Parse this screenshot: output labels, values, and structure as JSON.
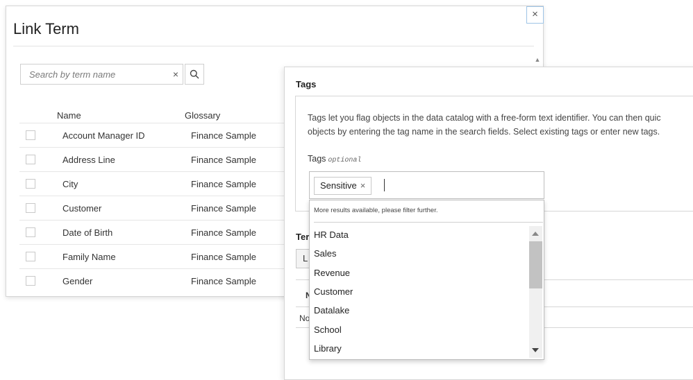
{
  "dialog": {
    "title": "Link Term",
    "close_label": "×",
    "search": {
      "placeholder": "Search by term name",
      "clear_label": "×"
    },
    "columns": {
      "name": "Name",
      "glossary": "Glossary"
    },
    "rows": [
      {
        "name": "Account Manager ID",
        "glossary": "Finance Sample"
      },
      {
        "name": "Address Line",
        "glossary": "Finance Sample"
      },
      {
        "name": "City",
        "glossary": "Finance Sample"
      },
      {
        "name": "Customer",
        "glossary": "Finance Sample"
      },
      {
        "name": "Date of Birth",
        "glossary": "Finance Sample"
      },
      {
        "name": "Family Name",
        "glossary": "Finance Sample"
      },
      {
        "name": "Gender",
        "glossary": "Finance Sample"
      }
    ]
  },
  "tags_panel": {
    "heading": "Tags",
    "description_line1": "Tags let you flag objects in the data catalog with a free-form text identifier. You can then quic",
    "description_line2": "objects by entering the tag name in the search fields. Select existing tags or enter new tags.",
    "field_label": "Tags",
    "field_optional": "optional",
    "chips": [
      {
        "label": "Sensitive",
        "remove": "×"
      }
    ],
    "terms_heading_partial": "Ter",
    "link_button_partial": "L",
    "table_col_partial": "N",
    "no_data_partial": "No"
  },
  "dropdown": {
    "note": "More results available, please filter further.",
    "items": [
      "HR Data",
      "Sales",
      "Revenue",
      "Customer",
      "Datalake",
      "School",
      "Library"
    ]
  }
}
